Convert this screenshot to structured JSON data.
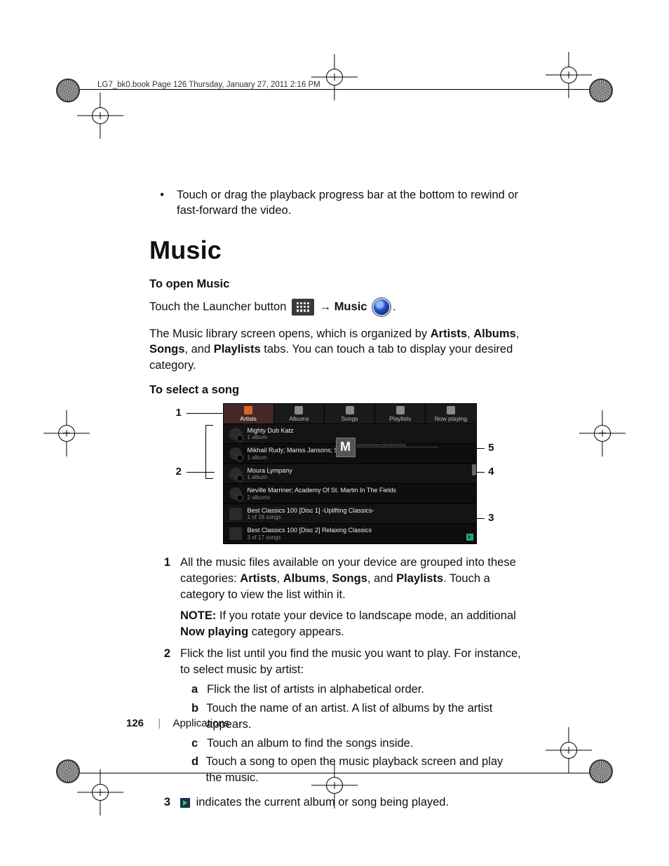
{
  "runhead": "LG7_bk0.book  Page 126  Thursday, January 27, 2011  2:16 PM",
  "intro_bullet": "Touch or drag the playback progress bar at the bottom to rewind or fast-forward the video.",
  "h1": "Music",
  "open_heading": "To open Music",
  "open_line_pre": "Touch the Launcher button",
  "open_arrow": "→",
  "open_music": "Music",
  "open_dot": ".",
  "library_p_pre": "The Music library screen opens, which is organized by ",
  "lib_b1": "Artists",
  "lib_c1": ", ",
  "lib_b2": "Albums",
  "lib_c2": ", ",
  "lib_b3": "Songs",
  "lib_c3": ", and ",
  "lib_b4": "Playlists",
  "library_p_post": " tabs. You can touch a tab to display your desired category.",
  "select_heading": "To select a song",
  "callouts": {
    "c1": "1",
    "c2": "2",
    "c3": "3",
    "c4": "4",
    "c5": "5"
  },
  "letter_overlay": "M",
  "overlay_name": "harmonic Orchestra",
  "tabs": [
    "Artists",
    "Albums",
    "Songs",
    "Playlists",
    "Now playing"
  ],
  "rows": [
    {
      "t": "Mighty Dub Katz",
      "s": "1 album"
    },
    {
      "t": "Mikhail Rudy; Mariss Jansons; St. Pet",
      "s": "1 album"
    },
    {
      "t": "Moura Lympany",
      "s": "1 album"
    },
    {
      "t": "Neville Marriner; Academy Of St. Martin In The Fields",
      "s": "2 albums"
    },
    {
      "t": "Best Classics 100 [Disc 1] -Uplifting Classics-",
      "s": "1 of 18 songs"
    },
    {
      "t": "Best Classics 100 [Disc 2] Relaxing Classics",
      "s": "3 of 17 songs"
    }
  ],
  "n1_pre": "All the music files available on your device are grouped into these categories: ",
  "n1_b1": "Artists",
  "n1_c1": ", ",
  "n1_b2": "Albums",
  "n1_c2": ", ",
  "n1_b3": "Songs",
  "n1_c3": ", and ",
  "n1_b4": "Playlists",
  "n1_post": ". Touch a category to view the list within it.",
  "note_label": "NOTE:",
  "note_pre": " If you rotate your device to landscape mode, an additional ",
  "note_b": "Now playing",
  "note_post": " category appears.",
  "n2_intro": "Flick the list until you find the music you want to play. For instance, to select music by artist:",
  "sub": {
    "a": "Flick the list of artists in alphabetical order.",
    "b": "Touch the name of an artist. A list of albums by the artist appears.",
    "c": "Touch an album to find the songs inside.",
    "d": "Touch a song to open the music playback screen and play the music."
  },
  "sublabels": {
    "a": "a",
    "b": "b",
    "c": "c",
    "d": "d"
  },
  "n3": " indicates the current album or song being played.",
  "nums": {
    "n1": "1",
    "n2": "2",
    "n3": "3"
  },
  "footer_page": "126",
  "footer_section": "Applications"
}
